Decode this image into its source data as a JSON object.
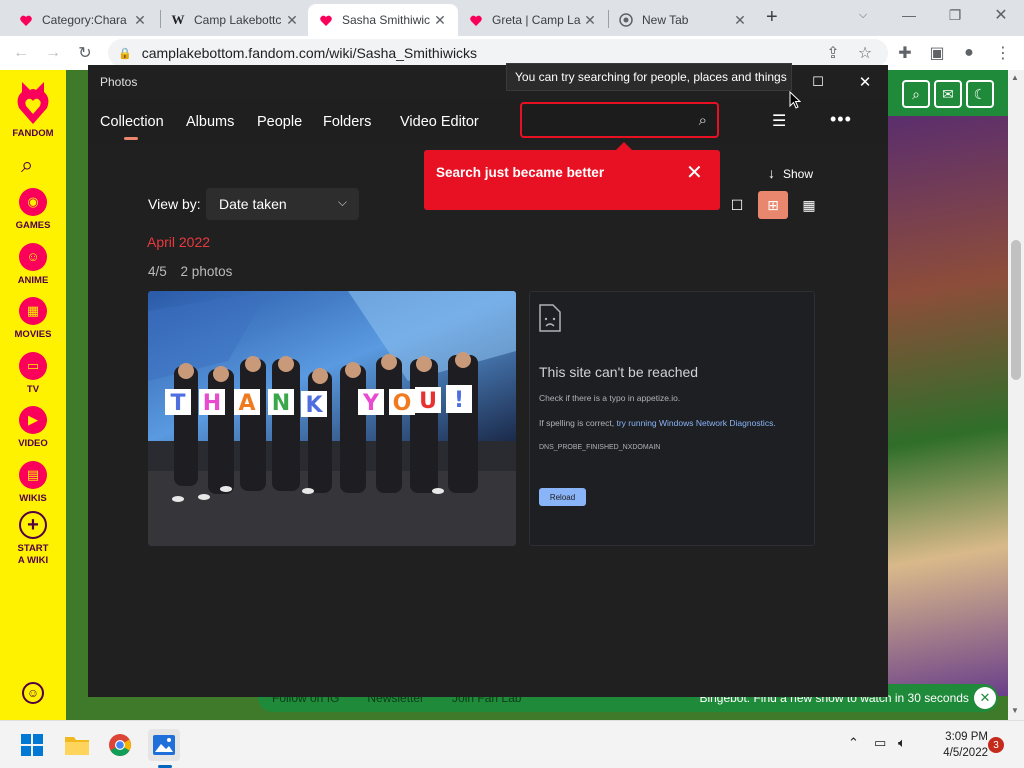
{
  "browser": {
    "tabs": [
      {
        "title": "Category:Chara",
        "favicon": "fandom-icon",
        "active": false
      },
      {
        "title": "Camp Lakebottc",
        "favicon": "wikipedia-icon",
        "active": false
      },
      {
        "title": "Sasha Smithiwic",
        "favicon": "fandom-icon",
        "active": true
      },
      {
        "title": "Greta | Camp La",
        "favicon": "fandom-icon",
        "active": false
      },
      {
        "title": "New Tab",
        "favicon": "chrome-icon",
        "active": false
      }
    ],
    "new_tab": "+",
    "url": "camplakebottom.fandom.com/wiki/Sasha_Smithiwicks"
  },
  "fandom_rail": {
    "logo_label": "FANDOM",
    "items": [
      {
        "label": "GAMES",
        "icon": "gamepad-icon"
      },
      {
        "label": "ANIME",
        "icon": "anime-icon"
      },
      {
        "label": "MOVIES",
        "icon": "movies-icon"
      },
      {
        "label": "TV",
        "icon": "tv-icon"
      },
      {
        "label": "VIDEO",
        "icon": "video-icon"
      },
      {
        "label": "WIKIS",
        "icon": "wikis-icon"
      },
      {
        "label": "START A WIKI",
        "icon": "plus-icon"
      }
    ]
  },
  "wiki": {
    "bottom_bar": {
      "items": [
        "Follow on IG",
        "Newsletter",
        "Join Fan Lab"
      ],
      "bingebot": "Bingebot: Find a new show to watch in 30 seconds"
    }
  },
  "photos": {
    "window_title": "Photos",
    "tabs": [
      "Collection",
      "Albums",
      "People",
      "Folders",
      "Video Editor"
    ],
    "active_tab": "Collection",
    "search": {
      "value": "",
      "placeholder": ""
    },
    "tooltip": "You can try searching for people, places and things",
    "teaching_tip": "Search just became better",
    "show_label": "Show",
    "view_by_label": "View by:",
    "view_by_value": "Date taken",
    "month_header": "April 2022",
    "date": "4/5",
    "count": "2 photos",
    "photo1": {
      "sign_letters": [
        "T",
        "H",
        "A",
        "N",
        "K",
        "Y",
        "O",
        "U",
        "!"
      ]
    },
    "error_card": {
      "title": "This site can't be reached",
      "line1": "Check if there is a typo in appetize.io.",
      "line2_prefix": "If spelling is correct, ",
      "line2_link": "try running Windows Network Diagnostics.",
      "code": "DNS_PROBE_FINISHED_NXDOMAIN",
      "reload": "Reload"
    }
  },
  "taskbar": {
    "time": "3:09 PM",
    "date": "4/5/2022",
    "notifications": "3"
  },
  "colors": {
    "photos_bg": "#202020",
    "accent": "#e8866e",
    "error_red": "#e81123",
    "fandom_yellow": "#fff200",
    "fandom_pink": "#fa005a",
    "wiki_green": "#1f8a3a"
  }
}
